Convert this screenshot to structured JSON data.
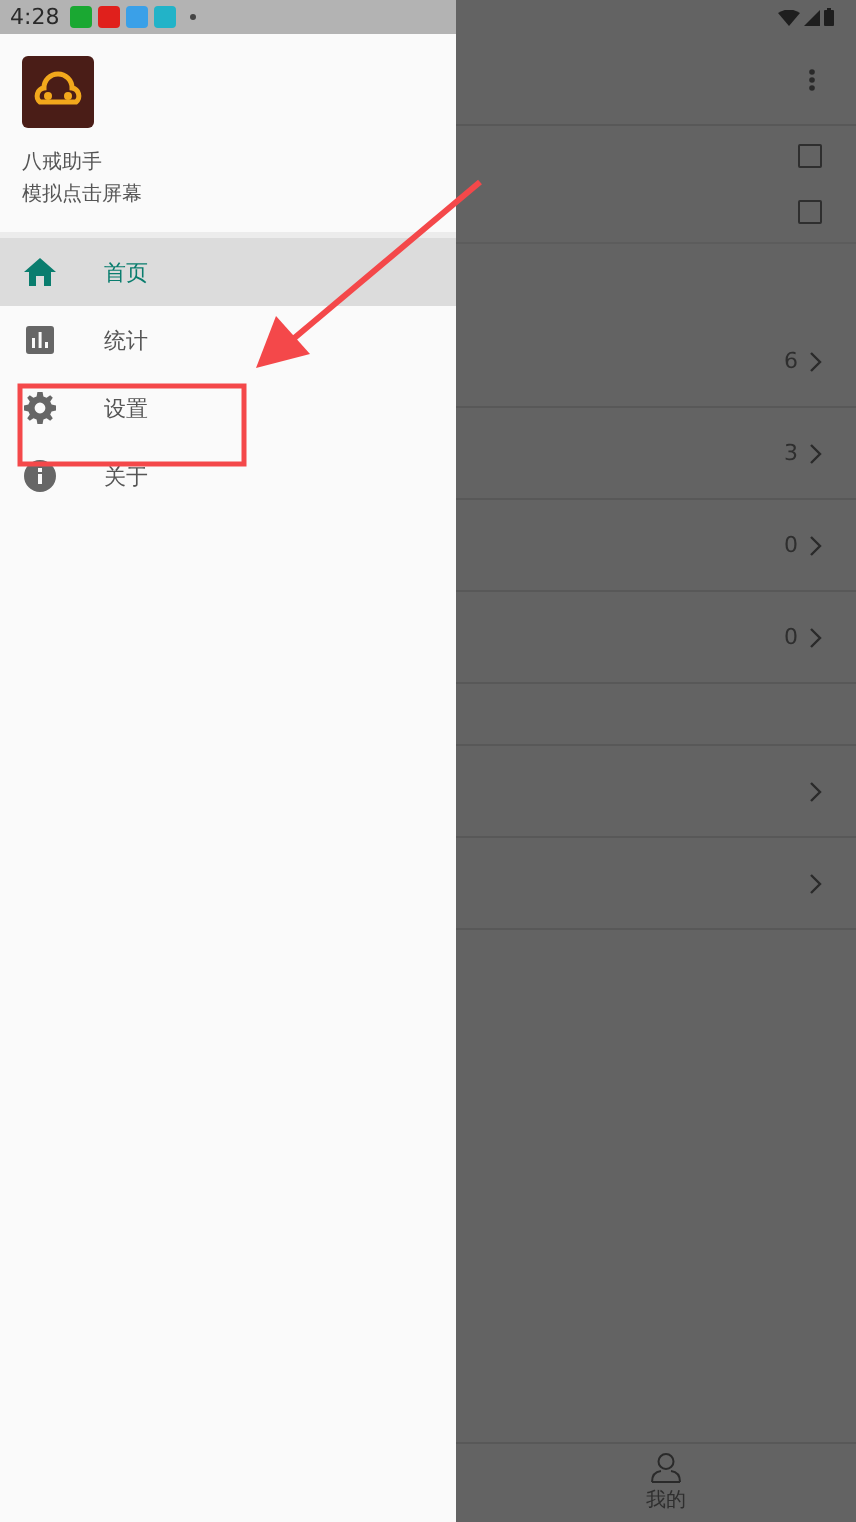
{
  "status_bar": {
    "time": "4:28",
    "notification_icons": [
      {
        "color": "#1aa832"
      },
      {
        "color": "#e0201c"
      },
      {
        "color": "#3aa0e8"
      },
      {
        "color": "#22b3c8"
      }
    ]
  },
  "drawer": {
    "app_name": "八戒助手",
    "subtitle": "模拟点击屏幕",
    "items": [
      {
        "label": "首页",
        "kind": "home",
        "selected": true
      },
      {
        "label": "统计",
        "kind": "chart",
        "selected": false
      },
      {
        "label": "设置",
        "kind": "gear",
        "selected": false
      },
      {
        "label": "关于",
        "kind": "info",
        "selected": false
      }
    ]
  },
  "background_screen": {
    "checkboxes": [
      {
        "checked": false
      },
      {
        "checked": false
      }
    ],
    "rows": [
      {
        "count": "6"
      },
      {
        "count": "3"
      },
      {
        "count": "0"
      },
      {
        "count": "0"
      }
    ],
    "more_rows": [
      {
        "kind": "link"
      },
      {
        "kind": "link"
      }
    ],
    "bottom_nav": [
      {
        "label": "我的"
      }
    ]
  }
}
